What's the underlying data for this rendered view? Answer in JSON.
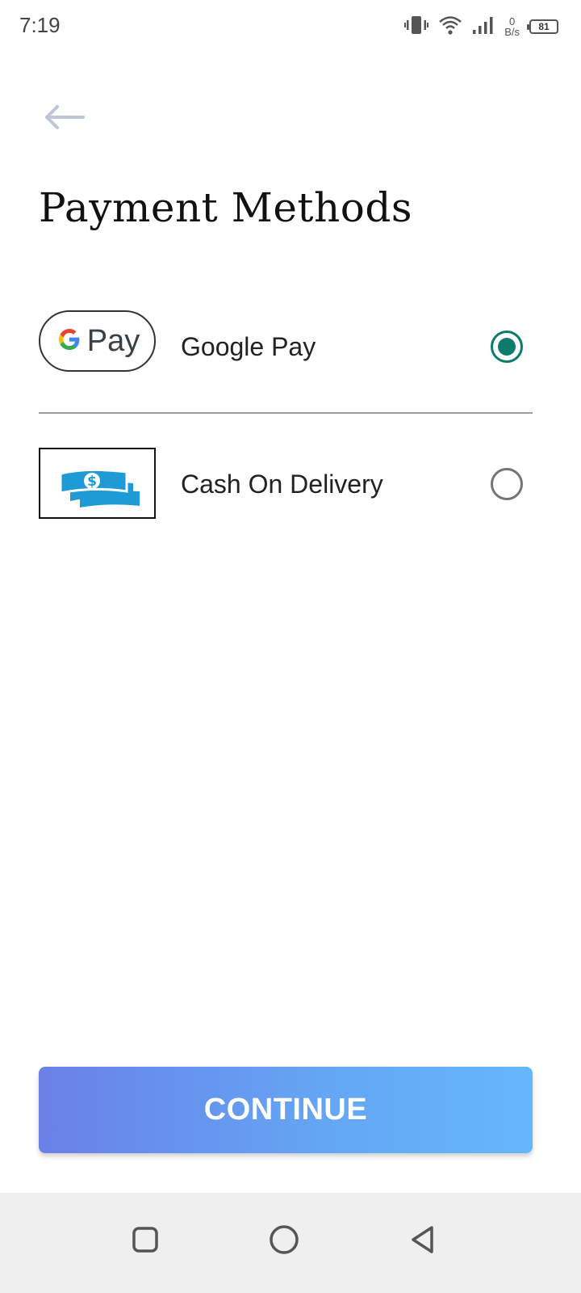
{
  "status_bar": {
    "time": "7:19",
    "net_speed_value": "0",
    "net_speed_unit": "B/s",
    "battery": "81",
    "icons": [
      "vibrate-icon",
      "wifi-icon",
      "signal-icon",
      "battery-icon"
    ]
  },
  "header": {
    "back_icon": "arrow-left-icon",
    "title": "Payment Methods"
  },
  "payment_methods": [
    {
      "logo_icon": "google-pay-logo",
      "logo_text": "Pay",
      "label": "Google Pay",
      "selected": true
    },
    {
      "logo_icon": "cash-money-icon",
      "label": "Cash On Delivery",
      "selected": false
    }
  ],
  "continue_label": "CONTINUE",
  "nav_bar": {
    "icons": [
      "recent-apps-icon",
      "home-icon",
      "back-icon"
    ]
  },
  "colors": {
    "radio_selected": "#0c7a6d",
    "button_gradient_start": "#6a80e8",
    "button_gradient_end": "#66b6fb",
    "cash_icon": "#1e9bd7"
  }
}
